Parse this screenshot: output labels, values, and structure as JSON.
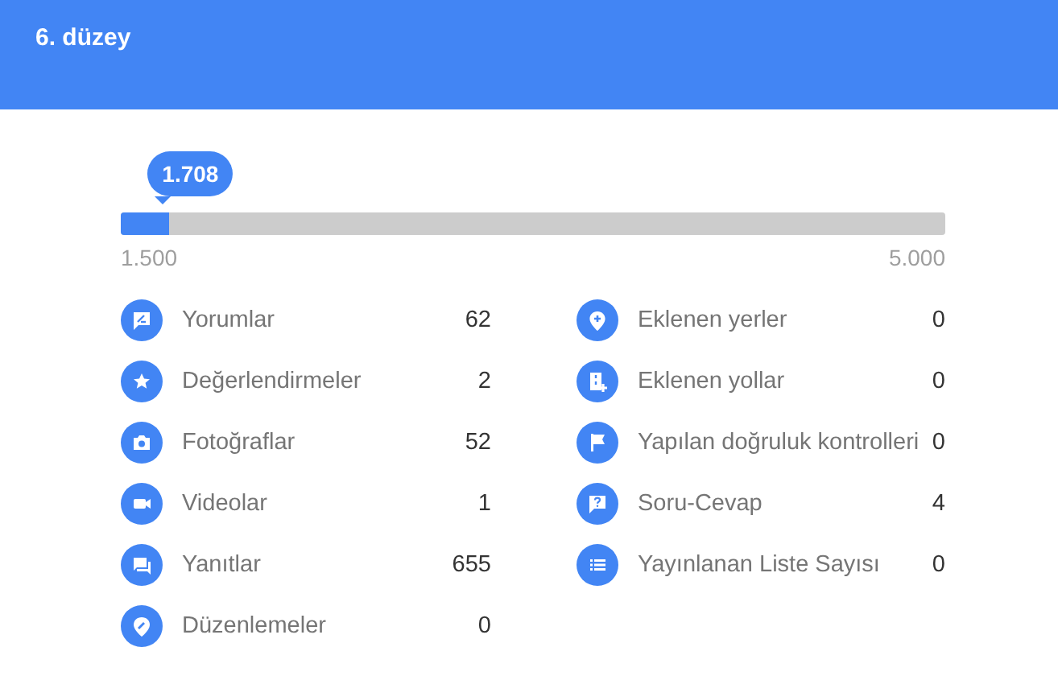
{
  "header": {
    "title": "6. düzey"
  },
  "progress": {
    "level": 0.0594,
    "value": "1.708",
    "min_label": "1.500",
    "max_label": "5.000"
  },
  "stats_left": [
    {
      "label": "Yorumlar",
      "value": "62"
    },
    {
      "label": "Değerlendirmeler",
      "value": "2"
    },
    {
      "label": "Fotoğraflar",
      "value": "52"
    },
    {
      "label": "Videolar",
      "value": "1"
    },
    {
      "label": "Yanıtlar",
      "value": "655"
    },
    {
      "label": "Düzenlemeler",
      "value": "0"
    }
  ],
  "stats_right": [
    {
      "label": "Eklenen yerler",
      "value": "0"
    },
    {
      "label": "Eklenen yollar",
      "value": "0"
    },
    {
      "label": "Yapılan doğruluk kontrolleri",
      "value": "0"
    },
    {
      "label": "Soru-Cevap",
      "value": "4"
    },
    {
      "label": "Yayınlanan Liste Sayısı",
      "value": "0"
    }
  ]
}
